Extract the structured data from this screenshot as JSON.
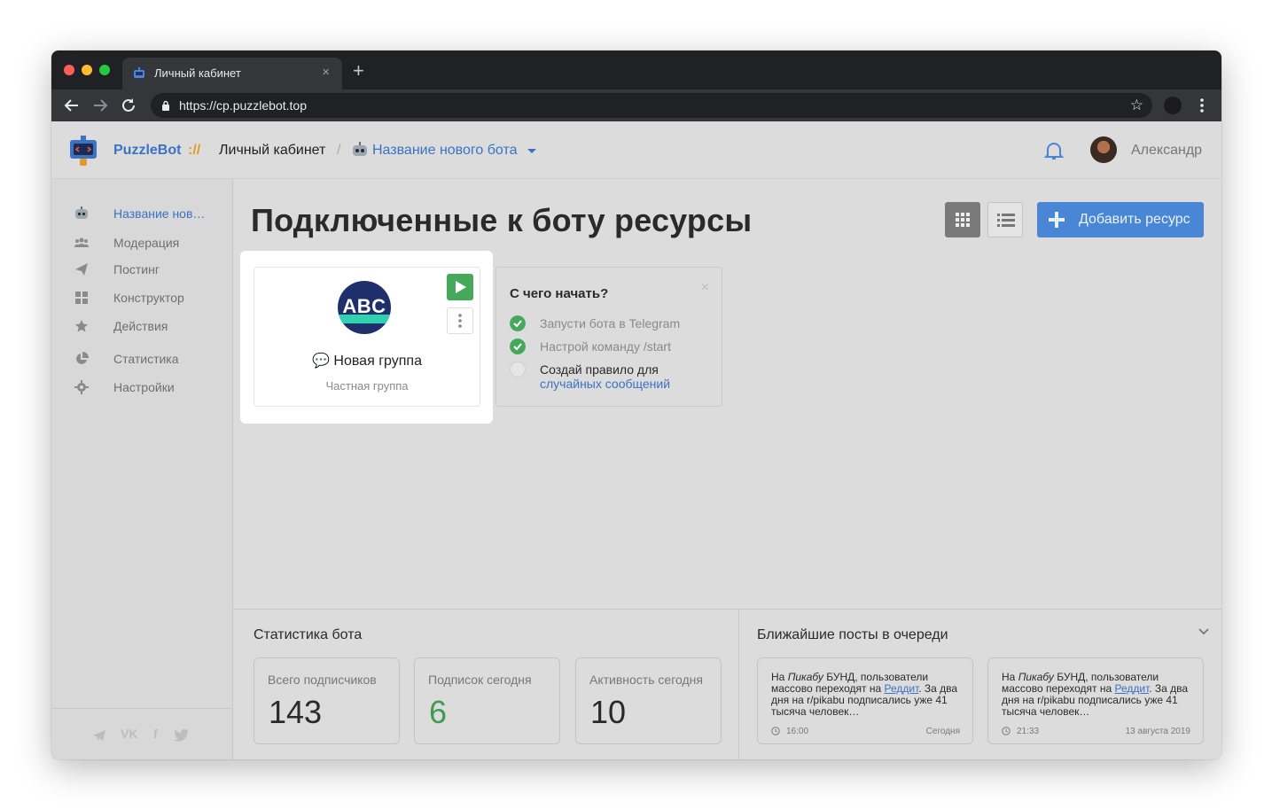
{
  "browser": {
    "tab_title": "Личный кабинет",
    "tab_close": "×",
    "new_tab": "+",
    "url": "https://cp.puzzlebot.top",
    "bookmark_star": "☆"
  },
  "header": {
    "brand": "PuzzleBot",
    "brand_separator": "://",
    "breadcrumb": "Личный кабинет",
    "breadcrumb_slash": "/",
    "bot_name": "Название нового бота",
    "user_name": "Александр"
  },
  "sidebar": {
    "items": [
      {
        "label": "Название нов…",
        "icon": "robot-icon"
      },
      {
        "label": "Модерация",
        "icon": "users-icon"
      },
      {
        "label": "Постинг",
        "icon": "paper-plane-icon"
      },
      {
        "label": "Конструктор",
        "icon": "grid-blocks-icon"
      },
      {
        "label": "Действия",
        "icon": "star-icon"
      },
      {
        "label": "Статистика",
        "icon": "pie-chart-icon"
      },
      {
        "label": "Настройки",
        "icon": "gear-icon"
      }
    ],
    "social": {
      "telegram": "telegram-icon",
      "vk": "VK",
      "facebook": "f",
      "twitter": "twitter-icon"
    }
  },
  "main": {
    "title": "Подключенные к боту ресурсы",
    "add_button": "Добавить ресурс",
    "view_modes": [
      "grid-view-icon",
      "list-view-icon"
    ]
  },
  "resource_card": {
    "logo_text": "ABC",
    "emoji": "💬",
    "name": "Новая группа",
    "type": "Частная группа"
  },
  "getting_started": {
    "title": "С чего начать?",
    "close": "×",
    "steps": [
      {
        "text": "Запусти бота в Telegram",
        "done": true
      },
      {
        "text": "Настрой команду /start",
        "done": true
      },
      {
        "text": "Создай правило для",
        "link": "случайных сообщений",
        "done": false
      }
    ]
  },
  "stats": {
    "title": "Статистика бота",
    "cards": [
      {
        "label": "Всего подписчиков",
        "value": "143"
      },
      {
        "label": "Подписок сегодня",
        "value": "6"
      },
      {
        "label": "Активность сегодня",
        "value": "10"
      }
    ]
  },
  "queue": {
    "title": "Ближайшие посты в очереди",
    "posts": [
      {
        "prefix": "На ",
        "italic": "Пикабу",
        "middle": " БУНД, пользователи массово переходят на ",
        "link": "Реддит",
        "suffix": ". За два дня на r/pikabu подписались уже 41 тысяча человек…",
        "time": "16:00",
        "date": "Сегодня"
      },
      {
        "prefix": "На ",
        "italic": "Пикабу",
        "middle": " БУНД, пользователи массово переходят на ",
        "link": "Реддит",
        "suffix": ". За два дня на r/pikabu подписались уже 41 тысяча человек…",
        "time": "21:33",
        "date": "13 августа 2019"
      }
    ]
  },
  "colors": {
    "accent_blue": "#4a86d6",
    "link_blue": "#3a72c4",
    "success_green": "#45a85a",
    "brand_orange": "#e39a2d"
  }
}
